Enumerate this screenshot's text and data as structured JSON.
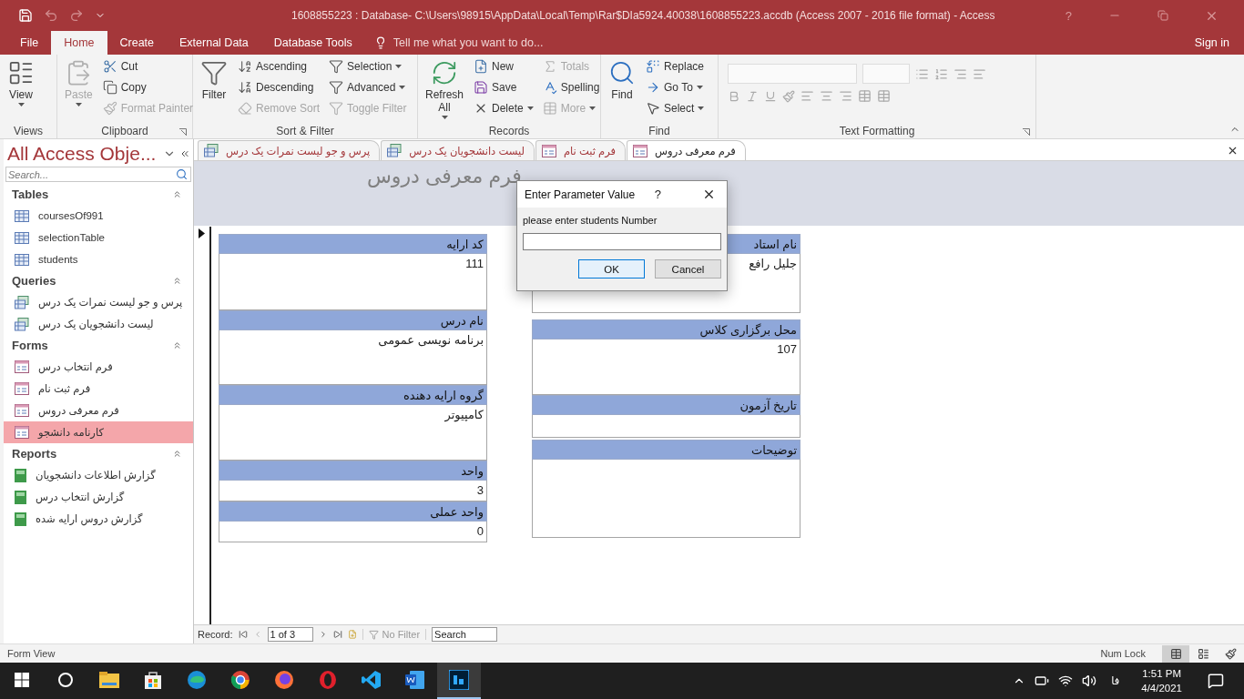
{
  "title_bar": {
    "title": "1608855223 : Database- C:\\Users\\98915\\AppData\\Local\\Temp\\Rar$DIa5924.40038\\1608855223.accdb (Access 2007 - 2016 file format) - Access",
    "help": "?"
  },
  "ribbon_tabs": [
    {
      "label": "Database Tools",
      "selected": false
    },
    {
      "label": "External Data",
      "selected": false
    },
    {
      "label": "Create",
      "selected": false
    },
    {
      "label": "Home",
      "selected": true
    },
    {
      "label": "File",
      "selected": false
    }
  ],
  "tell_me": {
    "placeholder": "Tell me what you want to do..."
  },
  "sign_in": "Sign in",
  "ribbon_groups": [
    {
      "name": "Text Formatting",
      "launcher": true
    },
    {
      "name": "Find",
      "launcher": false,
      "columns": [
        [
          {
            "label": "Replace",
            "kind": "small",
            "disabled": false,
            "dropdown": false
          },
          {
            "label": "Go To",
            "kind": "small",
            "disabled": false,
            "dropdown": true
          },
          {
            "label": "Select",
            "kind": "small",
            "disabled": false,
            "dropdown": true
          }
        ],
        [
          {
            "label": "Find",
            "kind": "large",
            "disabled": false,
            "dropdown": false
          }
        ]
      ]
    },
    {
      "name": "Records",
      "launcher": false,
      "columns": [
        [
          {
            "label": "Totals",
            "kind": "small",
            "disabled": true,
            "dropdown": false
          },
          {
            "label": "Spelling",
            "kind": "small",
            "disabled": false,
            "dropdown": false
          },
          {
            "label": "More",
            "kind": "small",
            "disabled": true,
            "dropdown": true
          }
        ],
        [
          {
            "label": "New",
            "kind": "small",
            "disabled": false,
            "dropdown": false
          },
          {
            "label": "Save",
            "kind": "small",
            "disabled": false,
            "dropdown": false
          },
          {
            "label": "Delete",
            "kind": "small",
            "disabled": false,
            "dropdown": true
          }
        ],
        [
          {
            "label": "Refresh All",
            "kind": "large",
            "disabled": false,
            "dropdown": true
          }
        ]
      ]
    },
    {
      "name": "Sort & Filter",
      "launcher": false,
      "columns": [
        [
          {
            "label": "Selection",
            "kind": "small",
            "disabled": false,
            "dropdown": true
          },
          {
            "label": "Advanced",
            "kind": "small",
            "disabled": false,
            "dropdown": true
          },
          {
            "label": "Toggle Filter",
            "kind": "small",
            "disabled": true,
            "dropdown": false
          }
        ],
        [
          {
            "label": "Ascending",
            "kind": "small",
            "disabled": false,
            "dropdown": false
          },
          {
            "label": "Descending",
            "kind": "small",
            "disabled": false,
            "dropdown": false
          },
          {
            "label": "Remove Sort",
            "kind": "small",
            "disabled": true,
            "dropdown": false
          }
        ],
        [
          {
            "label": "Filter",
            "kind": "large",
            "disabled": false,
            "dropdown": false
          }
        ]
      ]
    },
    {
      "name": "Clipboard",
      "launcher": true,
      "columns": [
        [
          {
            "label": "Cut",
            "kind": "small",
            "disabled": false,
            "dropdown": false
          },
          {
            "label": "Copy",
            "kind": "small",
            "disabled": false,
            "dropdown": false
          },
          {
            "label": "Format Painter",
            "kind": "small",
            "disabled": true,
            "dropdown": false
          }
        ],
        [
          {
            "label": "Paste",
            "kind": "large",
            "disabled": true,
            "dropdown": true
          }
        ]
      ]
    },
    {
      "name": "Views",
      "launcher": false,
      "columns": [
        [
          {
            "label": "View",
            "kind": "large",
            "disabled": false,
            "dropdown": true
          }
        ]
      ]
    }
  ],
  "nav_pane": {
    "title": "All Access Obje...",
    "search": {
      "placeholder": "Search..."
    },
    "groups": [
      {
        "name": "Tables",
        "items": [
          {
            "label": "coursesOf991",
            "kind": "table",
            "selected": false
          },
          {
            "label": "selectionTable",
            "kind": "table",
            "selected": false
          },
          {
            "label": "students",
            "kind": "table",
            "selected": false
          }
        ]
      },
      {
        "name": "Queries",
        "items": [
          {
            "label": "پرس و جو لیست نمرات یک درس",
            "kind": "query",
            "selected": false
          },
          {
            "label": "لیست دانشجویان یک درس",
            "kind": "query",
            "selected": false
          }
        ]
      },
      {
        "name": "Forms",
        "items": [
          {
            "label": "فرم انتخاب درس",
            "kind": "form",
            "selected": false
          },
          {
            "label": "فرم ثبت نام",
            "kind": "form",
            "selected": false
          },
          {
            "label": "فرم معرفی دروس",
            "kind": "form",
            "selected": false
          },
          {
            "label": "کارنامه دانشجو",
            "kind": "form",
            "selected": true
          }
        ]
      },
      {
        "name": "Reports",
        "items": [
          {
            "label": "گزارش اطلاعات دانشجویان",
            "kind": "report",
            "selected": false
          },
          {
            "label": "گزارش انتخاب درس",
            "kind": "report",
            "selected": false
          },
          {
            "label": "گزارش دروس ارایه شده",
            "kind": "report",
            "selected": false
          }
        ]
      }
    ]
  },
  "document_tabs": [
    {
      "label": "فرم معرفی دروس",
      "kind": "form",
      "selected": true
    },
    {
      "label": "فرم ثبت نام",
      "kind": "form",
      "selected": false
    },
    {
      "label": "لیست دانشجویان یک درس",
      "kind": "query",
      "selected": false
    },
    {
      "label": "پرس و جو لیست نمرات یک درس",
      "kind": "query",
      "selected": false
    }
  ],
  "form": {
    "title": "فرم معرفی دروس",
    "left_fields": [
      {
        "label": "کد ارایه",
        "value": "111"
      },
      {
        "label": "نام درس",
        "value": "برنامه نویسی عمومی"
      },
      {
        "label": "گروه ارایه دهنده",
        "value": "کامپیوتر"
      },
      {
        "label": "واحد",
        "value": "3"
      },
      {
        "label": "واحد عملی",
        "value": "0"
      }
    ],
    "right_fields": [
      {
        "label": "نام استاد",
        "value": "جلیل رافع"
      },
      {
        "label": "محل برگزاری کلاس",
        "value": "107"
      },
      {
        "label": "تاریخ آزمون"
      },
      {
        "label": "توضیحات"
      }
    ]
  },
  "dialog": {
    "title": "Enter Parameter Value",
    "help": "?",
    "prompt": "please enter students Number",
    "buttons": [
      {
        "label": "Cancel",
        "selected": false
      },
      {
        "label": "OK",
        "selected": true
      }
    ]
  },
  "record_nav": {
    "label": "Record:",
    "position": "1 of 3",
    "filter": "No Filter",
    "search": {
      "placeholder": "Search"
    }
  },
  "status_bar": {
    "view": "Form View",
    "num_lock": "Num Lock",
    "views": [
      {
        "selected": true
      },
      {
        "selected": false
      },
      {
        "selected": false
      }
    ]
  },
  "taskbar": {
    "apps": [
      {
        "selected": false
      },
      {
        "selected": false
      },
      {
        "selected": false
      },
      {
        "selected": false
      },
      {
        "selected": false
      },
      {
        "selected": false
      },
      {
        "selected": false
      },
      {
        "selected": false
      },
      {
        "selected": false
      },
      {
        "selected": false
      },
      {
        "selected": true
      }
    ],
    "language": "فا",
    "time": "1:51 PM",
    "date": "4/4/2021"
  }
}
